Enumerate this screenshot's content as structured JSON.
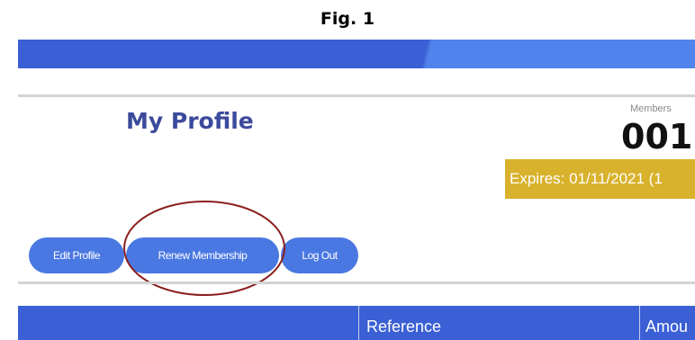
{
  "figure": {
    "label": "Fig. 1"
  },
  "profile": {
    "title": "My Profile",
    "membership_label": "Members",
    "membership_number": "001",
    "expires_text": "Expires: 01/11/2021 (1"
  },
  "actions": {
    "edit_profile": "Edit Profile",
    "renew_membership": "Renew Membership",
    "log_out": "Log Out"
  },
  "table": {
    "headers": [
      "",
      "Reference",
      "Amou"
    ]
  },
  "colors": {
    "banner_dark": "#3b5fd4",
    "banner_light": "#5183ec",
    "button": "#4a78e2",
    "title": "#3c4a9c",
    "expires_bg": "#d8b22c",
    "annotation": "#8b1e1e"
  }
}
